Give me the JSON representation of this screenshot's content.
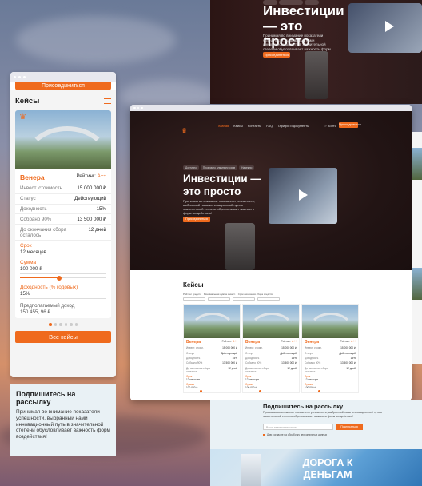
{
  "colors": {
    "accent": "#ef6a1d",
    "hero_bg": "#221414",
    "subscribe_bg": "#e9f1f5"
  },
  "top_hero": {
    "chips": [
      "",
      "",
      ""
    ],
    "title": "Инвестиции — это просто",
    "description": "Принимая во внимание показатели успешности, выбранный нами инновационный путь в значительной степени обусловливает важность форм воздействия!",
    "button": "Присоединиться"
  },
  "mobile": {
    "join_button": "Присоединиться",
    "cases_title": "Кейсы",
    "card": {
      "name": "Венера",
      "rating_label": "Рейтинг:",
      "rating_value": "A++",
      "rows": [
        {
          "label": "Инвест. стоимость",
          "value": "15 000 000 ₽"
        },
        {
          "label": "Статус",
          "value": "Действующий"
        },
        {
          "label": "Доходность",
          "value": "15%"
        },
        {
          "label": "Собрано 90%",
          "value": "13 500 000 ₽"
        },
        {
          "label": "До окончания сбора осталось",
          "value": "12 дней"
        }
      ],
      "term_label": "Срок",
      "term_value": "12 месяцев",
      "sum_label": "Сумма",
      "sum_value": "100 000 ₽",
      "yield_label": "Доходность (% годовых)",
      "yield_value": "15%",
      "income_label": "Предполагаемый доход",
      "income_value": "150 455, 96 ₽",
      "sum_slider": 0.45
    },
    "all_cases_button": "Все кейсы"
  },
  "subscribe_left": {
    "title": "Подпишитесь на рассылку",
    "description": "Принимая во внимание показатели успешности, выбранный нами инновационный путь в значительной степени обусловливает важность форм воздействия!"
  },
  "main": {
    "nav": {
      "logo": "♛",
      "menu": [
        "Главная",
        "Кейсы",
        "Контакты",
        "FAQ",
        "Тарифы и документы"
      ],
      "active_index": 0,
      "login": "Войти",
      "join": "Присоединиться"
    },
    "hero": {
      "chips": [
        "Доступно",
        "Прозрачно для инвесторов",
        "Надежно"
      ],
      "title": "Инвестиции — это просто",
      "description": "Принимая во внимание показатели успешности, выбранный нами инновационный путь в значительной степени обусловливает важность форм воздействия!",
      "button": "Присоединиться"
    },
    "cases": {
      "title": "Кейсы",
      "filters": [
        "Рейтинг кредита",
        "Минимальная сумма инвест.",
        "Срок окончания сбора средств"
      ],
      "selects": [
        "Все",
        "Сумма",
        "До окончания",
        "Доходность"
      ],
      "cards": [
        {
          "name": "Венера",
          "rating_label": "Рейтинг:",
          "rating_value": "A++",
          "rows": [
            {
              "label": "Инвест. стоим.",
              "value": "15 000 000 ₽"
            },
            {
              "label": "Статус",
              "value": "Действующий"
            },
            {
              "label": "Доходность",
              "value": "15%"
            },
            {
              "label": "Собрано 90%",
              "value": "13 500 000 ₽"
            },
            {
              "label": "До окончания сбора осталось",
              "value": "12 дней"
            }
          ],
          "term_label": "Срок",
          "term_value": "12 месяцев",
          "sum_label": "Сумма",
          "sum_value": "100 000 ₽"
        },
        {
          "name": "Венера",
          "rating_label": "Рейтинг:",
          "rating_value": "A++",
          "rows": [
            {
              "label": "Инвест. стоим.",
              "value": "15 000 000 ₽"
            },
            {
              "label": "Статус",
              "value": "Действующий"
            },
            {
              "label": "Доходность",
              "value": "15%"
            },
            {
              "label": "Собрано 90%",
              "value": "13 500 000 ₽"
            },
            {
              "label": "До окончания сбора осталось",
              "value": "12 дней"
            }
          ],
          "term_label": "Срок",
          "term_value": "12 месяцев",
          "sum_label": "Сумма",
          "sum_value": "100 000 ₽"
        },
        {
          "name": "Венера",
          "rating_label": "Рейтинг:",
          "rating_value": "A++",
          "rows": [
            {
              "label": "Инвест. стоим.",
              "value": "15 000 000 ₽"
            },
            {
              "label": "Статус",
              "value": "Действующий"
            },
            {
              "label": "Доходность",
              "value": "15%"
            },
            {
              "label": "Собрано 90%",
              "value": "13 500 000 ₽"
            },
            {
              "label": "До окончания сбора осталось",
              "value": "12 дней"
            }
          ],
          "term_label": "Срок",
          "term_value": "12 месяцев",
          "sum_label": "Сумма",
          "sum_value": "100 000 ₽"
        }
      ]
    }
  },
  "subscribe_bottom": {
    "title": "Подпишитесь на рассылку",
    "description": "Принимая во внимание показатели успешности, выбранный нами инновационный путь в значительной степени обусловливает важность форм воздействия!",
    "input_placeholder": "Ваша электронная почта",
    "button": "Подписаться",
    "agree": "Даю согласие на обработку персональных данных"
  },
  "road_banner": {
    "title": "ДОРОГА К ДЕНЬГАМ"
  }
}
